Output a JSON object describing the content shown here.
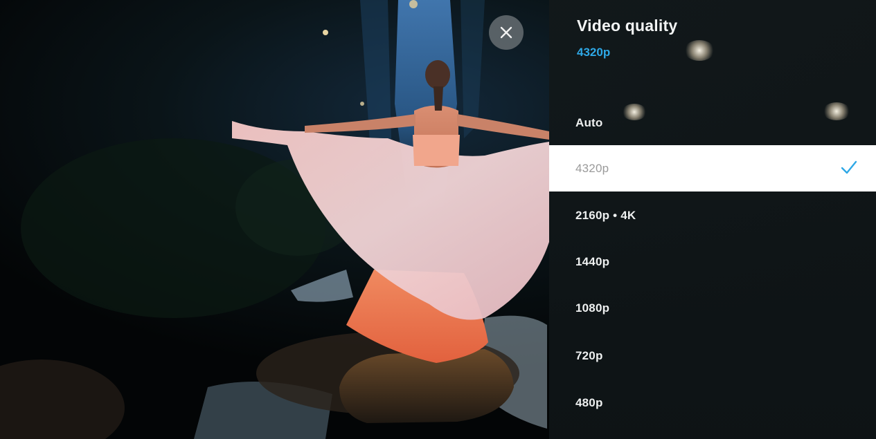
{
  "panel": {
    "title": "Video quality",
    "current": "4320p",
    "options": [
      {
        "label": "Auto",
        "selected": false
      },
      {
        "label": "4320p",
        "selected": true
      },
      {
        "label": "2160p • 4K",
        "selected": false
      },
      {
        "label": "1440p",
        "selected": false
      },
      {
        "label": "1080p",
        "selected": false
      },
      {
        "label": "720p",
        "selected": false
      },
      {
        "label": "480p",
        "selected": false
      }
    ]
  },
  "icons": {
    "close": "close-icon",
    "check": "checkmark-icon"
  },
  "colors": {
    "accent": "#2ea8e6",
    "panel_bg": "#12181a",
    "selected_bg": "#ffffff",
    "selected_text": "#9a9a9a",
    "option_text": "#eef0f0"
  }
}
